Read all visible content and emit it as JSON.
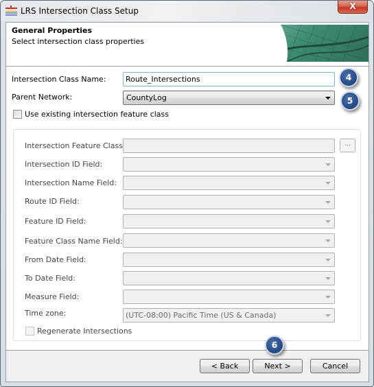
{
  "window": {
    "title": "LRS Intersection Class Setup",
    "close_label": "X",
    "icon": "lrs-app-icon"
  },
  "header": {
    "title": "General Properties",
    "subtitle": "Select intersection class properties",
    "banner": "map-banner-image"
  },
  "form": {
    "class_name_label": "Intersection Class Name:",
    "class_name_value": "Route_Intersections",
    "parent_network_label": "Parent Network:",
    "parent_network_value": "CountyLog",
    "use_existing_label": "Use existing intersection feature class",
    "use_existing_checked": false
  },
  "group": {
    "fields": [
      {
        "label": "Intersection Feature Class:",
        "value": "",
        "type": "text-browse"
      },
      {
        "label": "Intersection ID Field:",
        "value": "",
        "type": "combo"
      },
      {
        "label": "Intersection Name Field:",
        "value": "",
        "type": "combo"
      },
      {
        "label": "Route ID Field:",
        "value": "",
        "type": "combo"
      },
      {
        "label": "Feature ID Field:",
        "value": "",
        "type": "combo"
      },
      {
        "label": "Feature Class Name Field:",
        "value": "",
        "type": "combo"
      },
      {
        "label": "From Date Field:",
        "value": "",
        "type": "combo"
      },
      {
        "label": "To Date Field:",
        "value": "",
        "type": "combo"
      },
      {
        "label": "Measure Field:",
        "value": "",
        "type": "combo"
      },
      {
        "label": "Time zone:",
        "value": "(UTC-08:00) Pacific Time (US & Canada)",
        "type": "combo"
      }
    ],
    "browse_label": "...",
    "regenerate_label": "Regenerate Intersections",
    "regenerate_checked": false,
    "enabled": false
  },
  "buttons": {
    "back": "< Back",
    "next": "Next >",
    "cancel": "Cancel"
  },
  "callouts": {
    "c4": "4",
    "c5": "5",
    "c6": "6",
    "color": "#2b4f8c"
  }
}
